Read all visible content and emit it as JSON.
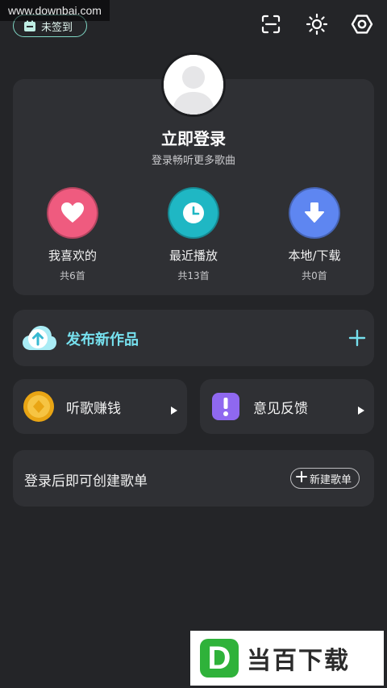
{
  "watermark": {
    "site": "www.downbai.com",
    "brand_letter": "D",
    "brand_name": "当百下载"
  },
  "topbar": {
    "checkin_label": "未签到"
  },
  "profile": {
    "login_title": "立即登录",
    "login_subtitle": "登录畅听更多歌曲",
    "shortcuts": [
      {
        "label": "我喜欢的",
        "count": "共6首",
        "color": "#ef5b7f",
        "icon": "heart-icon"
      },
      {
        "label": "最近播放",
        "count": "共13首",
        "color": "#1fb7c4",
        "icon": "clock-icon"
      },
      {
        "label": "本地/下载",
        "count": "共0首",
        "color": "#5e86f1",
        "icon": "download-icon"
      }
    ]
  },
  "publish": {
    "label": "发布新作品"
  },
  "earn": {
    "label": "听歌赚钱"
  },
  "feedback": {
    "label": "意见反馈"
  },
  "playlist": {
    "prompt": "登录后即可创建歌单",
    "new_button": "新建歌单"
  },
  "colors": {
    "background": "#242528",
    "card": "#2f3034",
    "accent_cyan": "#76e0ee"
  }
}
